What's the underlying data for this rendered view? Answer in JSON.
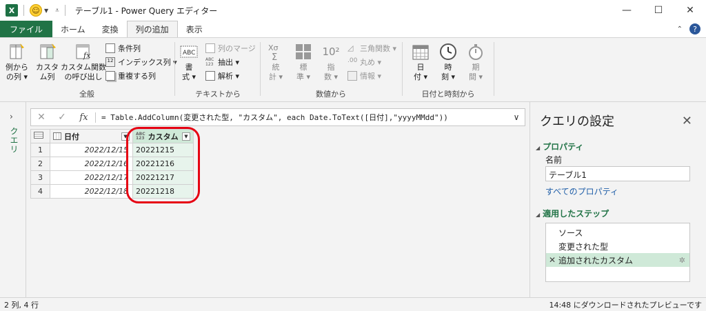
{
  "window": {
    "title": "テーブル1 - Power Query エディター",
    "app_icon": "X",
    "controls": {
      "minimize": "—",
      "maximize": "☐",
      "close": "✕"
    }
  },
  "tabs": [
    {
      "label": "ファイル"
    },
    {
      "label": "ホーム"
    },
    {
      "label": "変換"
    },
    {
      "label": "列の追加"
    },
    {
      "label": "表示"
    }
  ],
  "ribbon": {
    "general": {
      "label": "全般",
      "example_col": "例から\n の列 ▾",
      "example_col_l1": "例から",
      "example_col_l2": "の列 ▾",
      "custom_col_l1": "カスタ",
      "custom_col_l2": "ム列",
      "custom_func_l1": "カスタム関数",
      "custom_func_l2": "の呼び出し",
      "conditional_col": "条件列",
      "index_col": "インデックス列 ▾",
      "duplicate_col": "重複する列"
    },
    "text": {
      "label": "テキストから",
      "format_l1": "書",
      "format_l2": "式 ▾",
      "merge_cols": "列のマージ",
      "extract": "抽出 ▾",
      "parse": "解析 ▾",
      "abc_top": "ABC",
      "abc_bottom": "123"
    },
    "number": {
      "label": "数値から",
      "stats_l1": "統",
      "stats_l2": "計 ▾",
      "standard_l1": "標",
      "standard_l2": "準 ▾",
      "scientific_l1": "指",
      "scientific_l2": "数 ▾",
      "trig": "三角関数 ▾",
      "rounding": "丸め ▾",
      "info": "情報 ▾",
      "sci_glyph": "10²"
    },
    "datetime": {
      "label": "日付と時刻から",
      "date_l1": "日",
      "date_l2": "付 ▾",
      "time_l1": "時",
      "time_l2": "刻 ▾",
      "duration_l1": "期",
      "duration_l2": "間 ▾"
    }
  },
  "queries_pane": {
    "label": "クエリ",
    "chevron": "›"
  },
  "formula_bar": {
    "cancel": "✕",
    "confirm": "✓",
    "fx": "fx",
    "formula": "= Table.AddColumn(変更された型, \"カスタム\", each Date.ToText([日付],\"yyyyMMdd\"))",
    "expand": "∨"
  },
  "grid": {
    "columns": [
      {
        "name": "日付",
        "type": "date"
      },
      {
        "name": "カスタム",
        "type": "any",
        "type_top": "ABC",
        "type_bottom": "123"
      }
    ],
    "rows": [
      {
        "num": "1",
        "date": "2022/12/15",
        "custom": "20221215"
      },
      {
        "num": "2",
        "date": "2022/12/16",
        "custom": "20221216"
      },
      {
        "num": "3",
        "date": "2022/12/17",
        "custom": "20221217"
      },
      {
        "num": "4",
        "date": "2022/12/18",
        "custom": "20221218"
      }
    ]
  },
  "settings": {
    "title": "クエリの設定",
    "close": "✕",
    "properties_header": "プロパティ",
    "name_label": "名前",
    "name_value": "テーブル1",
    "all_properties": "すべてのプロパティ",
    "steps_header": "適用したステップ",
    "steps": [
      {
        "label": "ソース"
      },
      {
        "label": "変更された型"
      },
      {
        "label": "追加されたカスタム"
      }
    ]
  },
  "status": {
    "left": "2 列, 4 行",
    "right": "14:48 にダウンロードされたプレビューです"
  },
  "colors": {
    "accent_green": "#217346",
    "selected_col": "#cfe9d8",
    "highlight_outline": "#e60012"
  }
}
